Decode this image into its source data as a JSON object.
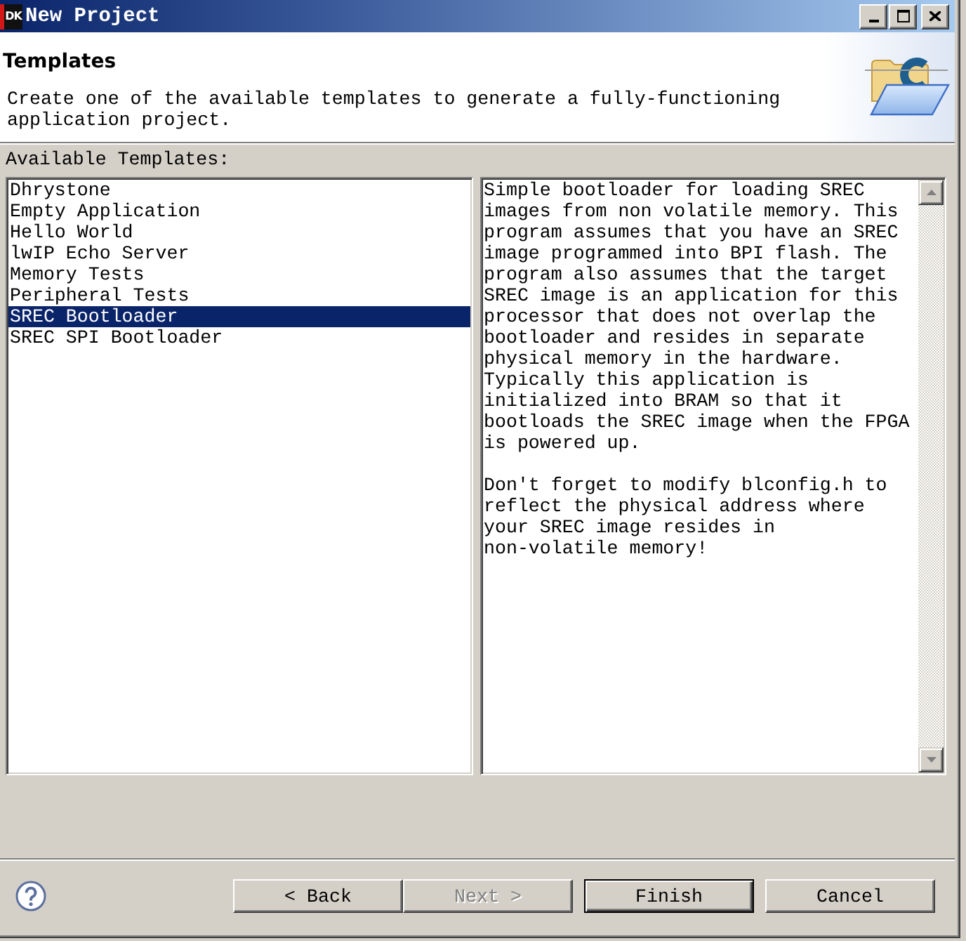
{
  "window": {
    "title": "New Project",
    "logo_text": "DK"
  },
  "header": {
    "title": "Templates",
    "description": "Create one of the available templates to generate a fully-functioning\napplication project."
  },
  "templates": {
    "label": "Available Templates:",
    "items": [
      {
        "label": "Dhrystone",
        "selected": false
      },
      {
        "label": "Empty Application",
        "selected": false
      },
      {
        "label": "Hello World",
        "selected": false
      },
      {
        "label": "lwIP Echo Server",
        "selected": false
      },
      {
        "label": "Memory Tests",
        "selected": false
      },
      {
        "label": "Peripheral Tests",
        "selected": false
      },
      {
        "label": "SREC Bootloader",
        "selected": true
      },
      {
        "label": "SREC SPI Bootloader",
        "selected": false
      }
    ]
  },
  "template_description": {
    "paragraphs": [
      "Simple bootloader for loading SREC\nimages from non volatile memory. This\nprogram assumes that you have an SREC\nimage programmed into BPI flash. The\nprogram also assumes that the target\nSREC image is an application for this\nprocessor that does not overlap the\nbootloader and resides in separate\nphysical memory in the hardware.\nTypically this application is\ninitialized into BRAM so that it\nbootloads the SREC image when the FPGA\nis powered up.",
      "Don't forget to modify blconfig.h to\nreflect the physical address where\nyour SREC image resides in\nnon-volatile memory!"
    ]
  },
  "buttons": [
    {
      "label": "< Back",
      "disabled": false,
      "default": false
    },
    {
      "label": "Next >",
      "disabled": true,
      "default": false
    },
    {
      "label": "Finish",
      "disabled": false,
      "default": true
    },
    {
      "label": "Cancel",
      "disabled": false,
      "default": false
    }
  ]
}
